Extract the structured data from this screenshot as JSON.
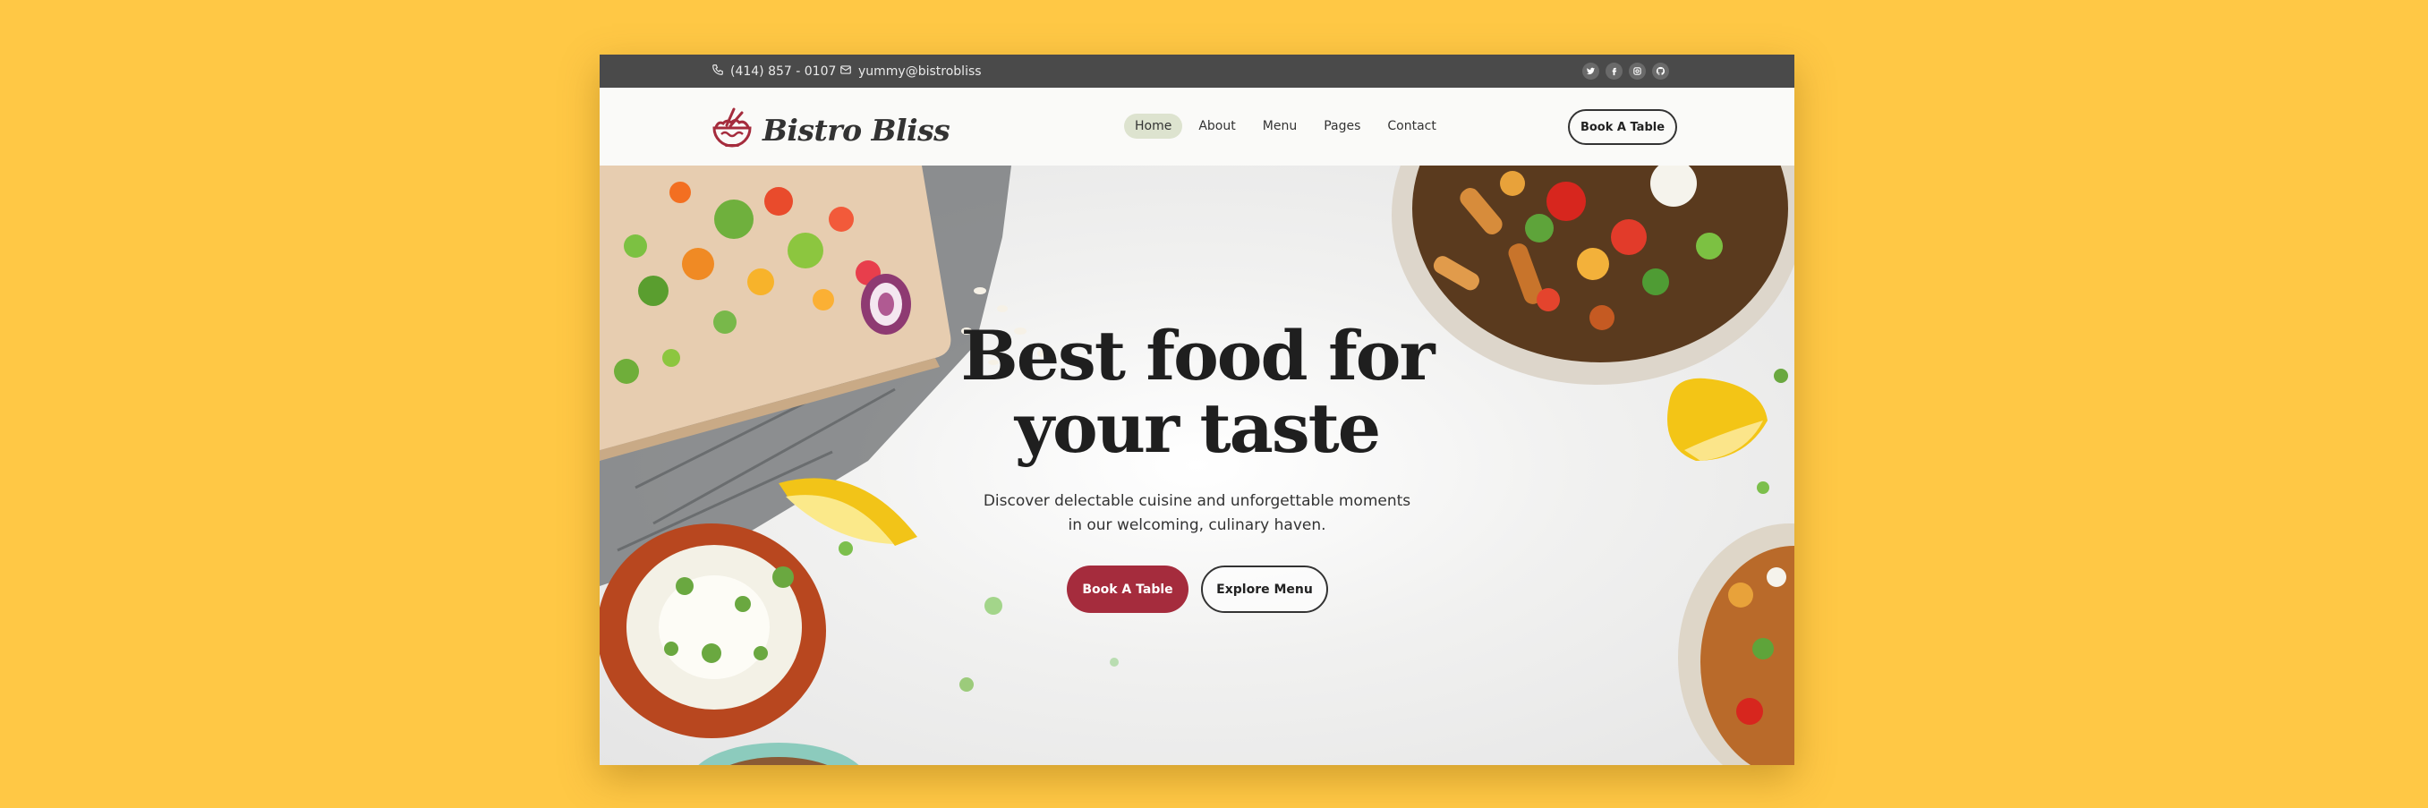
{
  "topbar": {
    "phone": "(414) 857 - 0107",
    "email": "yummy@bistrobliss",
    "socials": [
      "twitter-icon",
      "facebook-icon",
      "instagram-icon",
      "github-icon"
    ]
  },
  "header": {
    "logo_text": "Bistro Bliss",
    "nav": [
      {
        "label": "Home",
        "active": true
      },
      {
        "label": "About"
      },
      {
        "label": "Menu"
      },
      {
        "label": "Pages"
      },
      {
        "label": "Contact"
      }
    ],
    "cta": "Book A Table"
  },
  "hero": {
    "title_line1": "Best food for",
    "title_line2": "your taste",
    "subtitle_line1": "Discover delectable cuisine and unforgettable moments",
    "subtitle_line2": "in our welcoming, culinary haven.",
    "primary_button": "Book A Table",
    "secondary_button": "Explore Menu"
  },
  "colors": {
    "page_background": "#FFC845",
    "topbar": "#4a4a4a",
    "brand_red": "#a52c3d",
    "active_nav": "#dde3cf"
  }
}
